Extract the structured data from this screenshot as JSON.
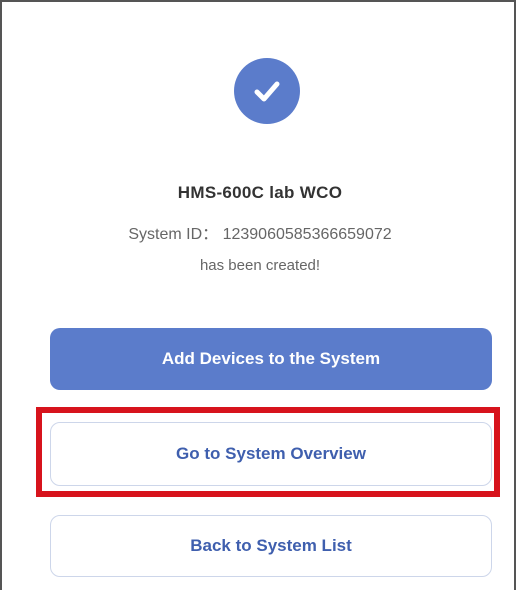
{
  "success": {
    "icon": "check-icon",
    "system_name": "HMS-600C lab WCO",
    "system_id_line": "System ID： 1239060585366659072",
    "status": "has been created!"
  },
  "actions": {
    "add_devices_label": "Add Devices to the System",
    "overview_label": "Go to System Overview",
    "back_label": "Back to System List"
  },
  "colors": {
    "accent": "#5b7ccb",
    "highlight": "#d7131c",
    "outline_text": "#3f5fae"
  }
}
